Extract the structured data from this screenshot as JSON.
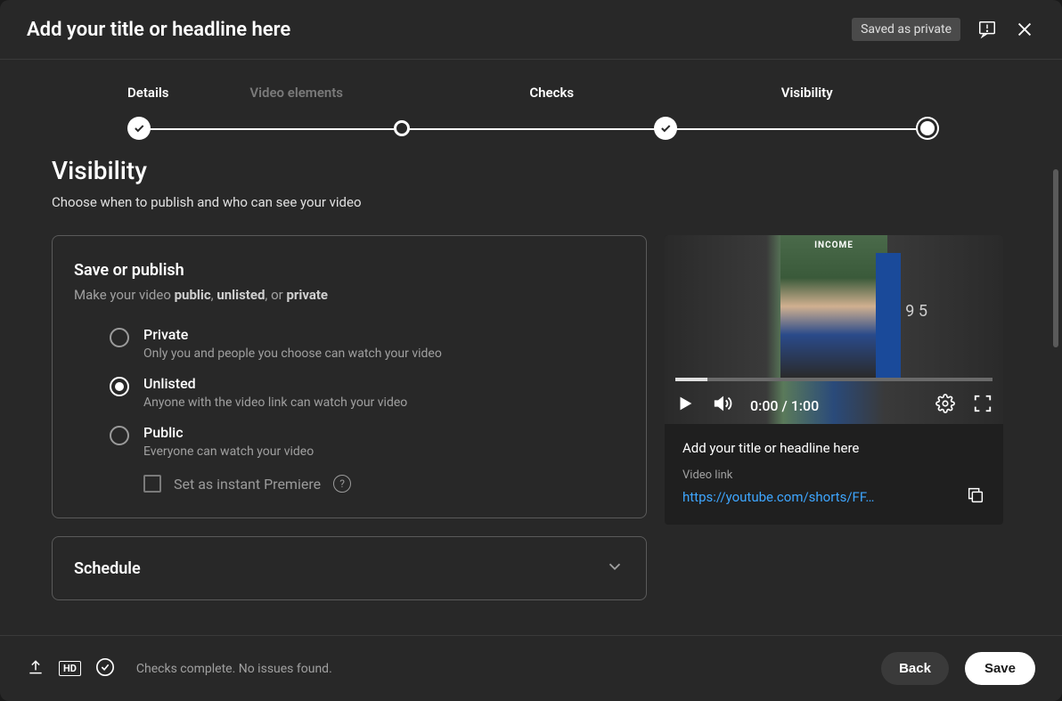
{
  "header": {
    "title": "Add your title or headline here",
    "badge": "Saved as private"
  },
  "stepper": {
    "steps": [
      {
        "label": "Details"
      },
      {
        "label": "Video elements"
      },
      {
        "label": "Checks"
      },
      {
        "label": "Visibility"
      }
    ]
  },
  "visibility": {
    "heading": "Visibility",
    "subtitle": "Choose when to publish and who can see your video",
    "save_publish": {
      "title": "Save or publish",
      "sub_pre": "Make your video ",
      "sub_b1": "public",
      "sub_sep1": ", ",
      "sub_b2": "unlisted",
      "sub_sep2": ", or ",
      "sub_b3": "private",
      "options": [
        {
          "label": "Private",
          "desc": "Only you and people you choose can watch your video",
          "selected": false
        },
        {
          "label": "Unlisted",
          "desc": "Anyone with the video link can watch your video",
          "selected": true
        },
        {
          "label": "Public",
          "desc": "Everyone can watch your video",
          "selected": false
        }
      ],
      "premiere": "Set as instant Premiere"
    },
    "schedule": {
      "title": "Schedule"
    }
  },
  "preview": {
    "thumb_title": "INCOME",
    "num_right": "9 5",
    "time": "0:00 / 1:00",
    "title": "Add your title or headline here",
    "link_label": "Video link",
    "link": "https://youtube.com/shorts/FF…"
  },
  "footer": {
    "hd": "HD",
    "status": "Checks complete. No issues found.",
    "back": "Back",
    "save": "Save"
  }
}
